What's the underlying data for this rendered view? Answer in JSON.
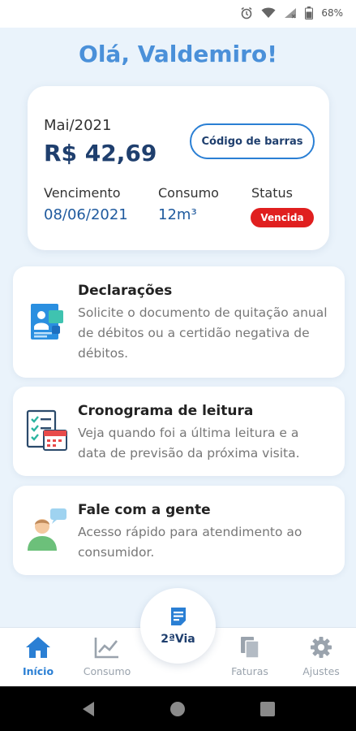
{
  "status_bar": {
    "battery": "68%"
  },
  "greeting": "Olá, Valdemiro!",
  "bill": {
    "month": "Mai/2021",
    "amount": "R$ 42,69",
    "barcode_button": "Código de barras",
    "due_label": "Vencimento",
    "due_date": "08/06/2021",
    "consumption_label": "Consumo",
    "consumption_value": "12m³",
    "status_label": "Status",
    "status_value": "Vencida"
  },
  "menu": [
    {
      "title": "Declarações",
      "description": "Solicite o documento de quitação anual de débitos ou a certidão negativa de débitos.",
      "icon": "document-certificate-icon"
    },
    {
      "title": "Cronograma de leitura",
      "description": "Veja quando foi a última leitura e a data de previsão da próxima visita.",
      "icon": "checklist-calendar-icon"
    },
    {
      "title": "Fale com a gente",
      "description": "Acesso rápido para atendimento ao consumidor.",
      "icon": "person-chat-icon"
    }
  ],
  "bottom_nav": {
    "home": "Início",
    "consumption": "Consumo",
    "second_copy": "2ªVia",
    "invoices": "Faturas",
    "settings": "Ajustes"
  },
  "colors": {
    "accent": "#2a7fd4",
    "dark_blue": "#1f3f6e",
    "overdue_red": "#e01f1f",
    "background": "#eaf3fb"
  }
}
